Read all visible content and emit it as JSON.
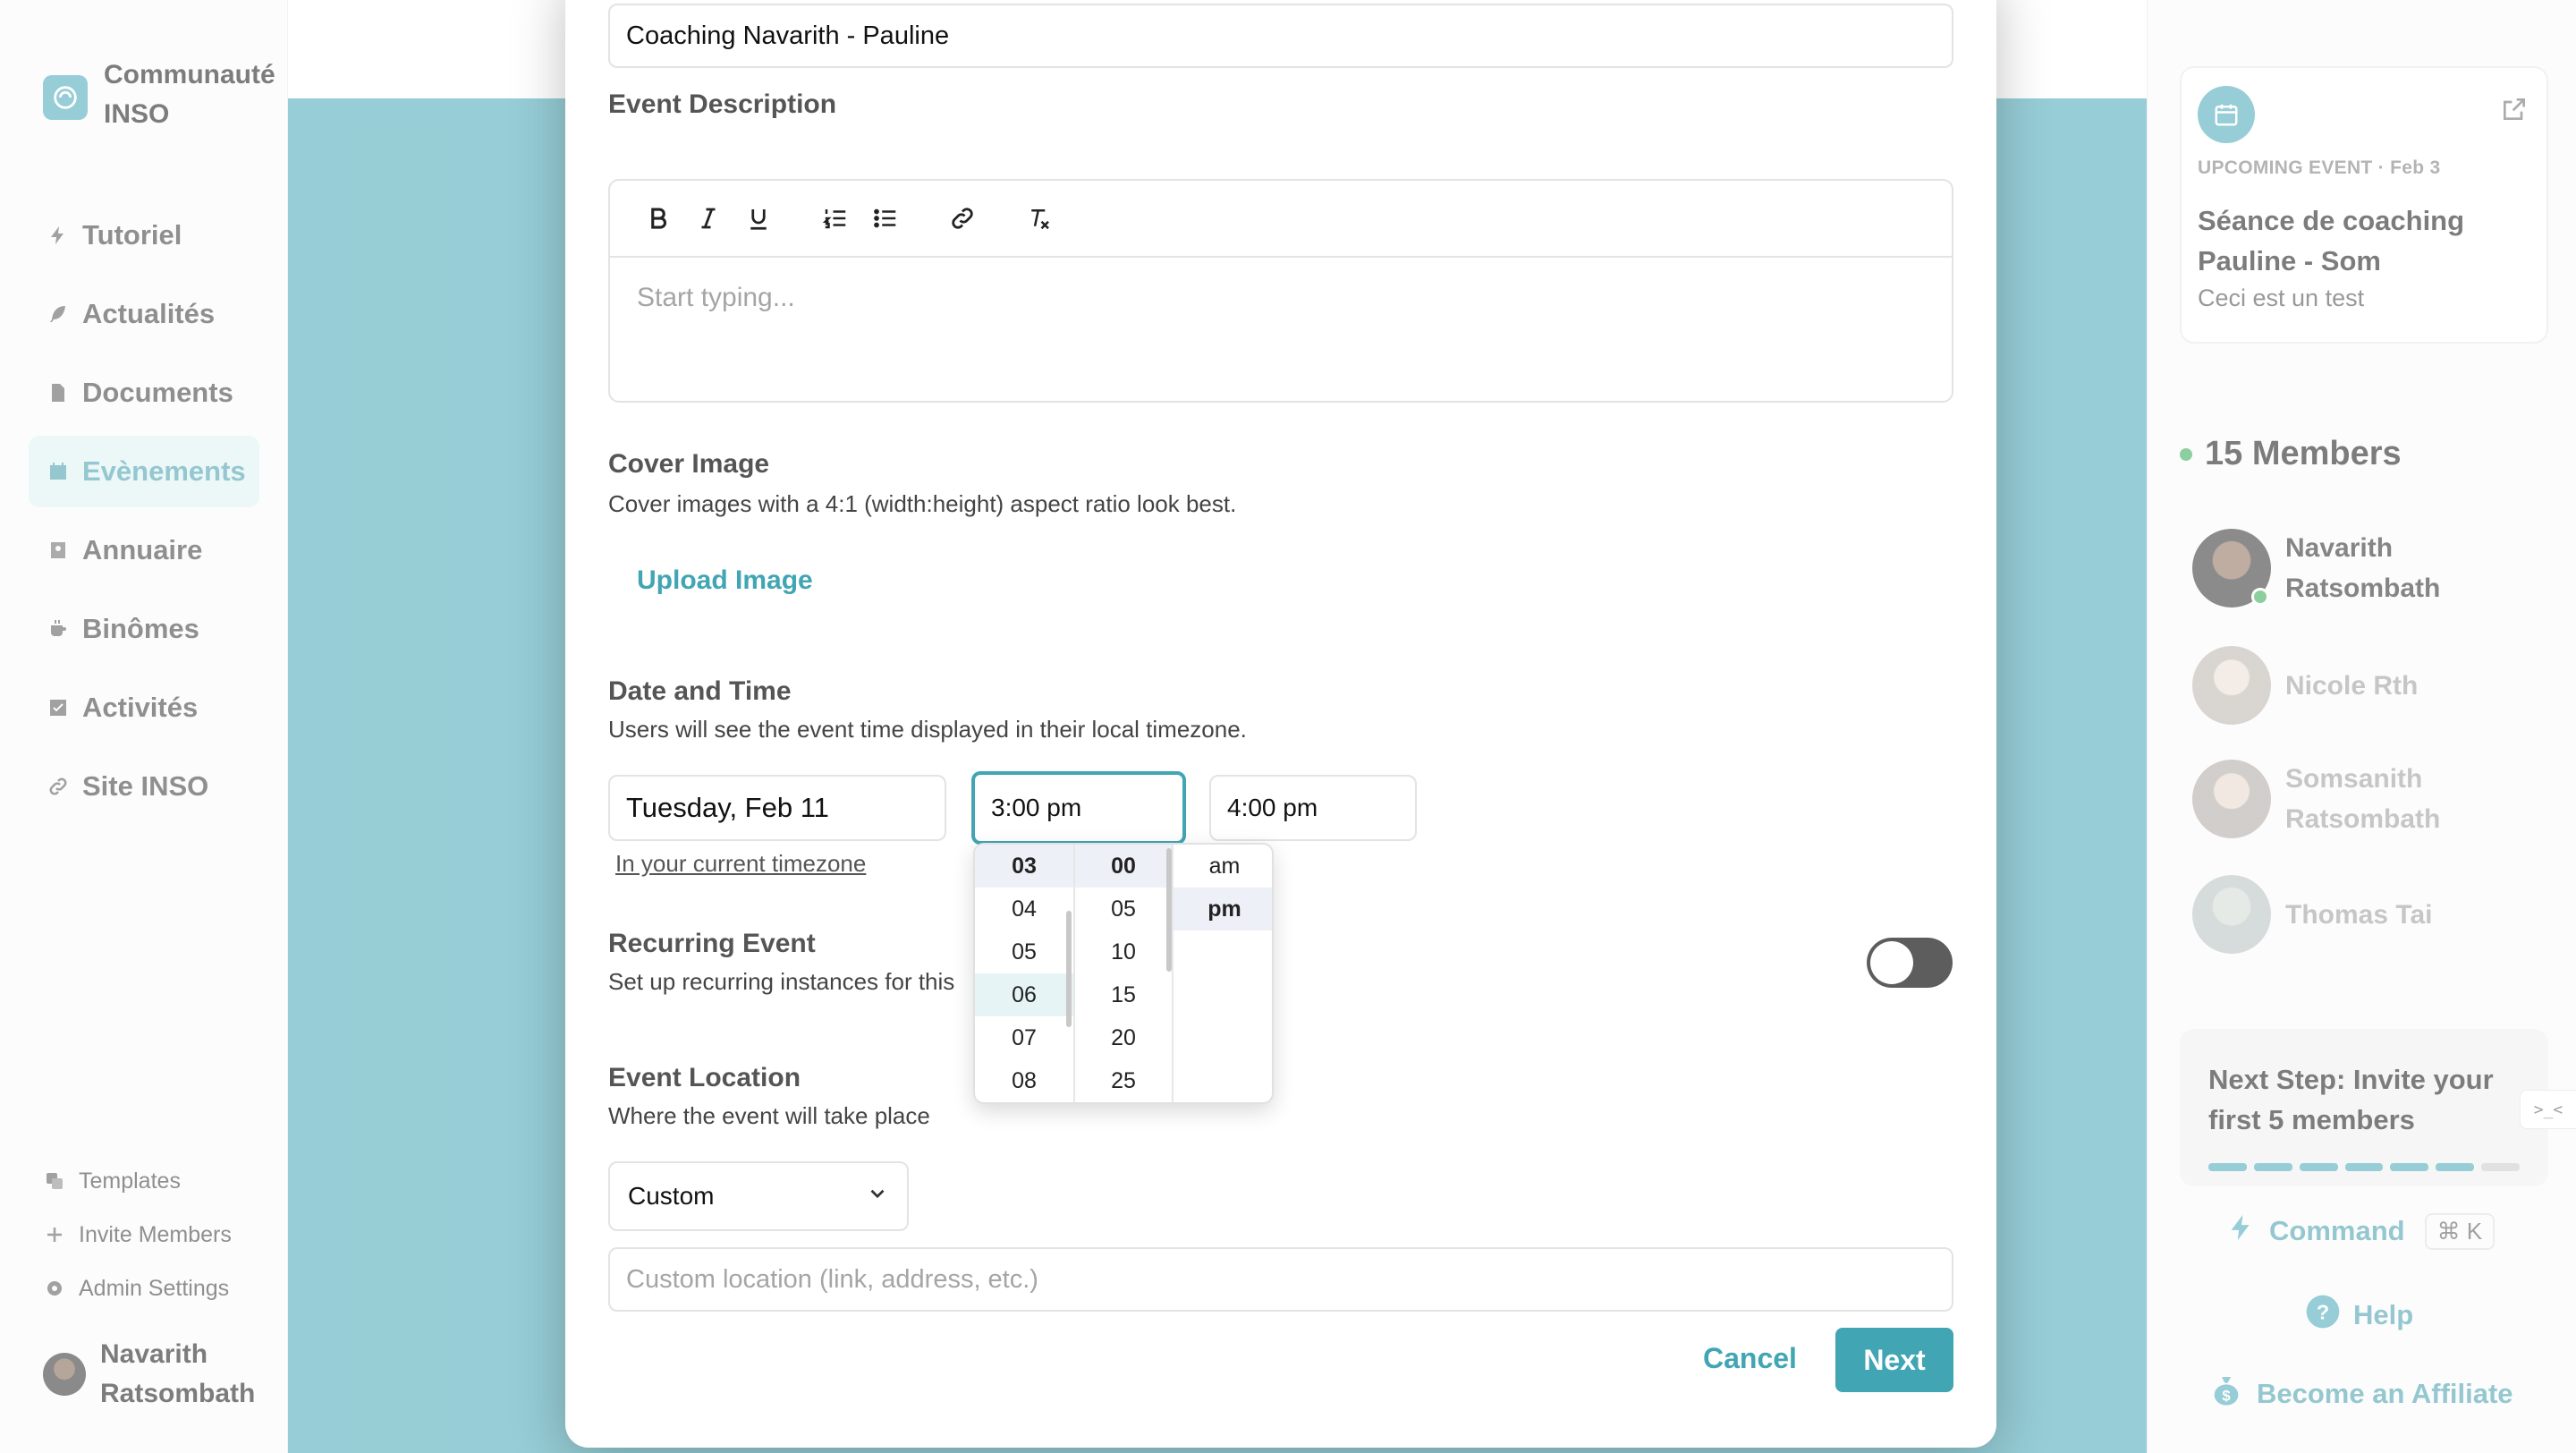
{
  "sidebar": {
    "brand": "Communauté INSO",
    "nav": [
      {
        "label": "Tutoriel",
        "icon": "bolt-icon"
      },
      {
        "label": "Actualités",
        "icon": "feather-icon"
      },
      {
        "label": "Documents",
        "icon": "document-icon"
      },
      {
        "label": "Evènements",
        "icon": "calendar-icon",
        "active": true
      },
      {
        "label": "Annuaire",
        "icon": "contact-icon"
      },
      {
        "label": "Binômes",
        "icon": "coffee-icon"
      },
      {
        "label": "Activités",
        "icon": "checklist-icon"
      },
      {
        "label": "Site INSO",
        "icon": "link-icon"
      }
    ],
    "bottom_links": [
      {
        "label": "Templates",
        "icon": "templates-icon"
      },
      {
        "label": "Invite Members",
        "icon": "plus-icon"
      },
      {
        "label": "Admin Settings",
        "icon": "gear-icon"
      }
    ],
    "user": "Navarith Ratsombath"
  },
  "modal": {
    "event_name_value": "Coaching Navarith - Pauline",
    "description_label": "Event Description",
    "description_placeholder": "Start typing...",
    "cover_label": "Cover Image",
    "cover_hint": "Cover images with a 4:1 (width:height) aspect ratio look best.",
    "upload_label": "Upload Image",
    "datetime_label": "Date and Time",
    "datetime_hint": "Users will see the event time displayed in their local timezone.",
    "date_value": "Tuesday, Feb 11",
    "start_time_value": "3:00 pm",
    "end_time_value": "4:00 pm",
    "timezone_link": "In your current timezone",
    "recurring_label": "Recurring Event",
    "recurring_hint": "Set up recurring instances for this",
    "recurring_enabled": false,
    "location_label": "Event Location",
    "location_hint": "Where the event will take place",
    "location_type": "Custom",
    "location_placeholder": "Custom location (link, address, etc.)",
    "cancel_label": "Cancel",
    "next_label": "Next"
  },
  "timepicker": {
    "hours": [
      "03",
      "04",
      "05",
      "06",
      "07",
      "08"
    ],
    "minutes": [
      "00",
      "05",
      "10",
      "15",
      "20",
      "25"
    ],
    "periods": [
      "am",
      "pm"
    ],
    "selected_hour": "03",
    "selected_minute": "00",
    "selected_period": "pm"
  },
  "rightpanel": {
    "upcoming_kicker": "UPCOMING EVENT · Feb 3",
    "upcoming_title": "Séance de coaching Pauline - Som",
    "upcoming_desc": "Ceci est un test",
    "members_count": "15 Members",
    "members": [
      "Navarith Ratsombath",
      "Nicole Rth",
      "Somsanith Ratsombath",
      "Thomas Tai"
    ],
    "next_step": "Next Step: Invite your first 5 members",
    "next_step_progress": "6 of 7",
    "dev_tab": ">_<",
    "command_label": "Command",
    "command_shortcut": "⌘ K",
    "help_label": "Help",
    "affiliate_label": "Become an Affiliate"
  },
  "colors": {
    "accent": "#41a5b4",
    "online": "#2fa84f"
  }
}
